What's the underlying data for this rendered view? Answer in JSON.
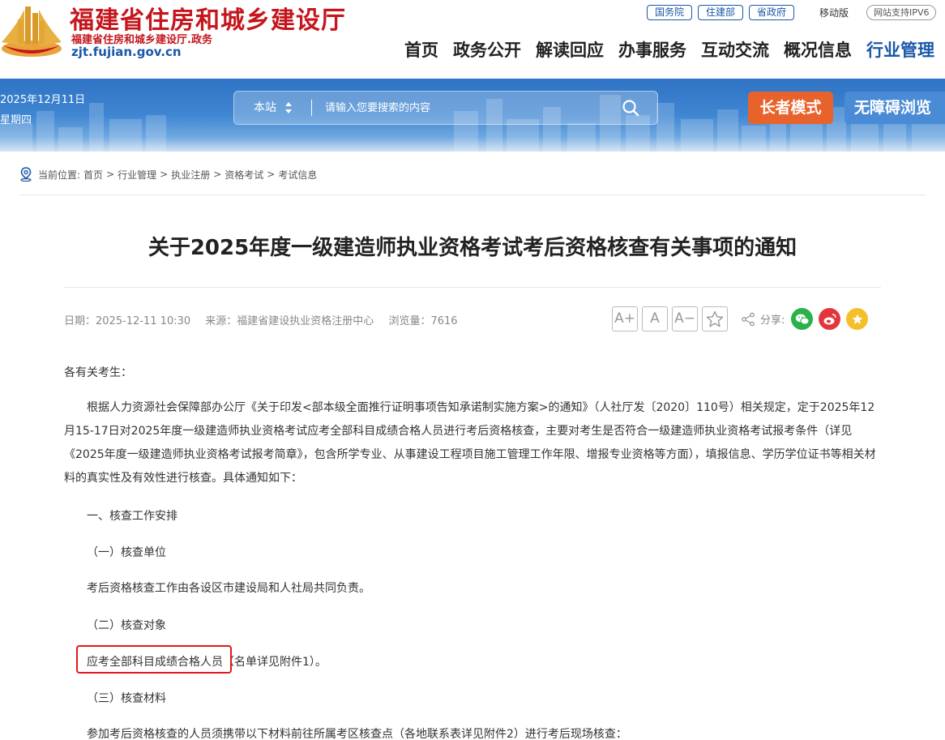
{
  "site": {
    "title": "福建省住房和城乡建设厅",
    "subtitle": "福建省住房和城乡建设厅.政务",
    "url": "zjt.fujian.gov.cn",
    "brand_red": "#c4161c",
    "brand_blue": "#1a58a8"
  },
  "top_links": [
    "国务院",
    "住建部",
    "省政府"
  ],
  "top_mobile": "移动版",
  "top_ipv6": "网站支持IPV6",
  "nav": [
    "首页",
    "政务公开",
    "解读回应",
    "办事服务",
    "互动交流",
    "概况信息",
    "行业管理"
  ],
  "nav_active_index": 6,
  "banner": {
    "date_line1": "2025年12月11日",
    "date_line2": "星期四",
    "search_scope": "本站",
    "search_placeholder": "请输入您要搜索的内容",
    "elder_mode": "长者模式",
    "accessible": "无障碍浏览",
    "elder_color": "#e8632c"
  },
  "breadcrumb": {
    "label": "当前位置:",
    "items": [
      "首页",
      "行业管理",
      "执业注册",
      "资格考试",
      "考试信息"
    ]
  },
  "article": {
    "title": "关于2025年度一级建造师执业资格考试考后资格核查有关事项的通知",
    "meta_date": "日期：2025-12-11 10:30",
    "meta_source": "来源：福建省建设执业资格注册中心",
    "meta_views": "浏览量：7616",
    "font_plus": "A+",
    "font_normal": "A",
    "font_minus": "A−",
    "share_label": "分享:",
    "greeting": "各有关考生：",
    "intro": "根据人力资源社会保障部办公厅《关于印发<部本级全面推行证明事项告知承诺制实施方案>的通知》（人社厅发〔2020〕110号）相关规定，定于2025年12月15-17日对2025年度一级建造师执业资格考试应考全部科目成绩合格人员进行考后资格核查，主要对考生是否符合一级建造师执业资格考试报考条件（详见《2025年度一级建造师执业资格考试报考简章》，包含所学专业、从事建设工程项目施工管理工作年限、增报专业资格等方面），填报信息、学历学位证书等相关材料的真实性及有效性进行核查。具体通知如下：",
    "section1": "一、核查工作安排",
    "sub1": "（一）核查单位",
    "sub1_text": "考后资格核查工作由各设区市建设局和人社局共同负责。",
    "sub2": "（二）核查对象",
    "sub2_text_highlight": "应考全部科目成绩合格人员",
    "sub2_text_rest": "（名单详见附件1）。",
    "sub3": "（三）核查材料",
    "sub3_text": "参加考后资格核查的人员须携带以下材料前往所属考区核查点（各地联系表详见附件2）进行考后现场核查："
  }
}
